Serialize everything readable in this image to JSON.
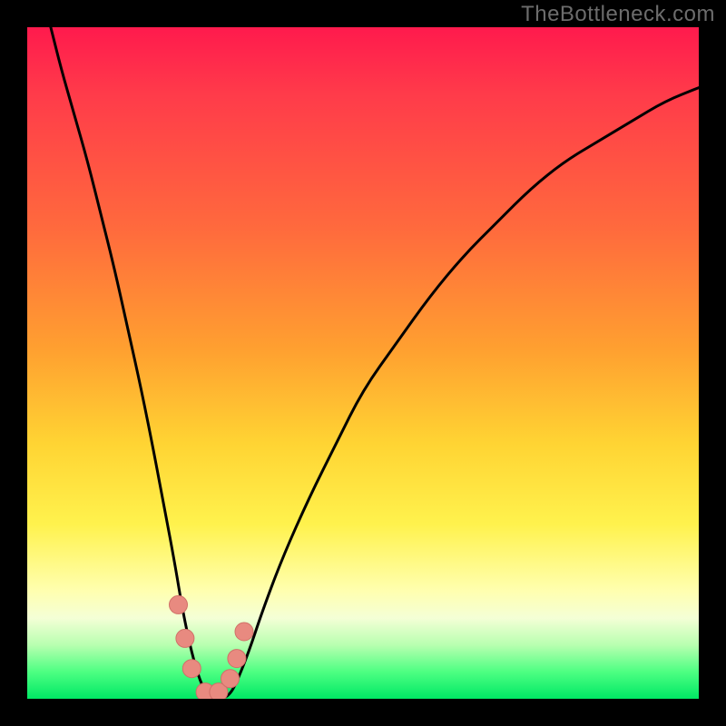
{
  "watermark": "TheBottleneck.com",
  "chart_data": {
    "type": "line",
    "title": "",
    "xlabel": "",
    "ylabel": "",
    "xlim": [
      0,
      100
    ],
    "ylim": [
      0,
      100
    ],
    "x": [
      3.5,
      5,
      7,
      9,
      11,
      13,
      15,
      17,
      19,
      20.5,
      22,
      23,
      24,
      25,
      26,
      27,
      28,
      29,
      30,
      31,
      33,
      35,
      38,
      42,
      46,
      50,
      55,
      60,
      65,
      70,
      75,
      80,
      85,
      90,
      95,
      100
    ],
    "values": [
      100,
      94,
      87,
      80,
      72,
      64,
      55,
      46,
      36,
      28,
      20,
      14,
      9,
      5,
      2,
      0.5,
      0,
      0,
      0.5,
      2,
      7,
      13,
      21,
      30,
      38,
      46,
      53,
      60,
      66,
      71,
      76,
      80,
      83,
      86,
      89,
      91
    ],
    "markers": {
      "x": [
        22.5,
        23.5,
        24.5,
        26.5,
        28.5,
        30.2,
        31.2,
        32.3
      ],
      "y": [
        14,
        9,
        4.5,
        1,
        1,
        3,
        6,
        10
      ]
    },
    "annotations": [],
    "grid": false,
    "legend": null
  },
  "colors": {
    "curve": "#000000",
    "marker_fill": "#e88a80",
    "marker_stroke": "#d07068"
  }
}
